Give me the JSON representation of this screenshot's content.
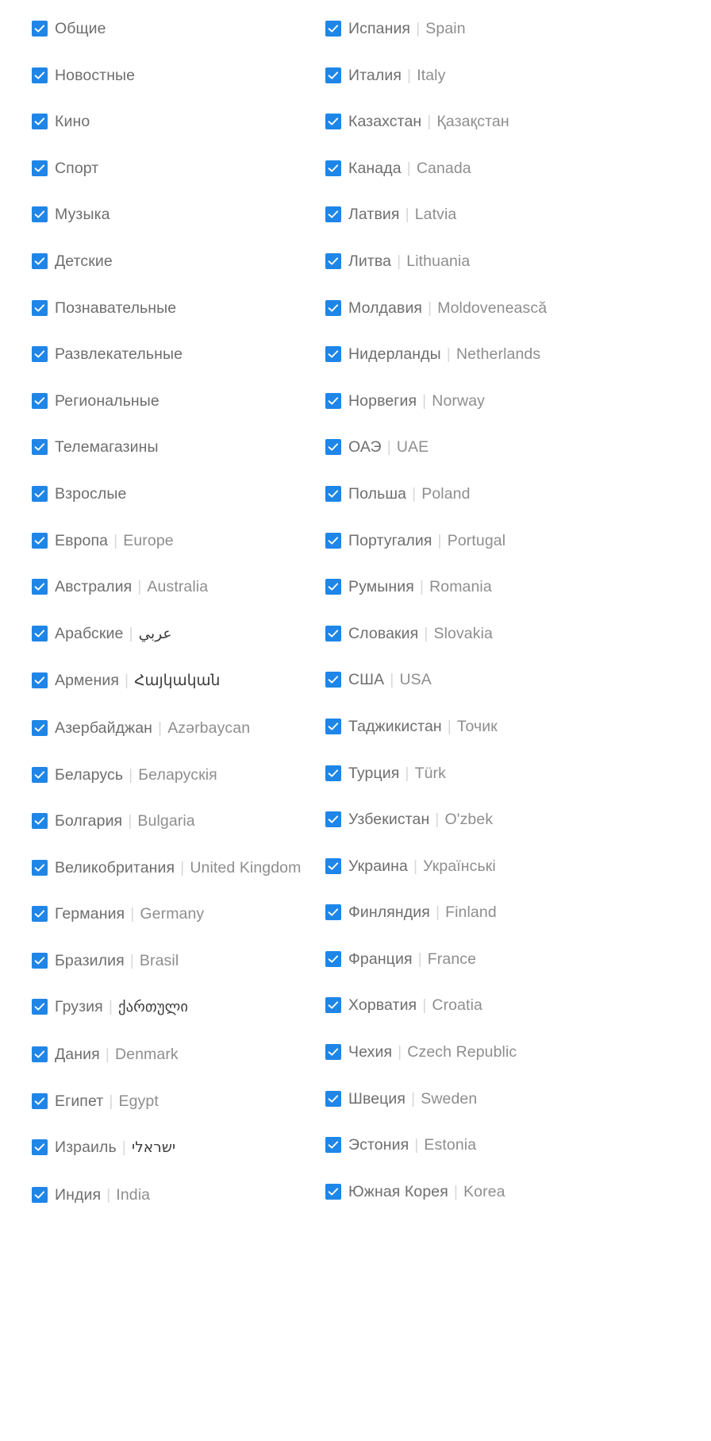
{
  "icons": {
    "checkbox_checked": "checkbox-checked-icon"
  },
  "colors": {
    "checkbox_fill": "#1f86e8",
    "checkmark": "#ffffff",
    "label_primary": "#6e6e6e",
    "label_secondary": "#8e8e8e",
    "separator": "#d8d8d8",
    "background": "#ffffff"
  },
  "separator": "|",
  "left_column": {
    "items": [
      {
        "main": "Общие",
        "sub": "",
        "script": ""
      },
      {
        "main": "Новостные",
        "sub": "",
        "script": ""
      },
      {
        "main": "Кино",
        "sub": "",
        "script": ""
      },
      {
        "main": "Спорт",
        "sub": "",
        "script": ""
      },
      {
        "main": "Музыка",
        "sub": "",
        "script": ""
      },
      {
        "main": "Детские",
        "sub": "",
        "script": ""
      },
      {
        "main": "Познавательные",
        "sub": "",
        "script": ""
      },
      {
        "main": "Развлекательные",
        "sub": "",
        "script": ""
      },
      {
        "main": "Региональные",
        "sub": "",
        "script": ""
      },
      {
        "main": "Телемагазины",
        "sub": "",
        "script": ""
      },
      {
        "main": "Взрослые",
        "sub": "",
        "script": ""
      },
      {
        "main": "Европа",
        "sub": "Europe",
        "script": ""
      },
      {
        "main": "Австралия",
        "sub": "Australia",
        "script": ""
      },
      {
        "main": "Арабские",
        "sub": "عربي",
        "script": "arabic"
      },
      {
        "main": "Армения",
        "sub": "Հայկական",
        "script": "armenian"
      },
      {
        "main": "Азербайджан",
        "sub": "Azərbaycan",
        "script": ""
      },
      {
        "main": "Беларусь",
        "sub": "Беларускія",
        "script": ""
      },
      {
        "main": "Болгария",
        "sub": "Bulgaria",
        "script": ""
      },
      {
        "main": "Великобритания",
        "sub": "United Kingdom",
        "script": ""
      },
      {
        "main": "Германия",
        "sub": "Germany",
        "script": ""
      },
      {
        "main": "Бразилия",
        "sub": "Brasil",
        "script": ""
      },
      {
        "main": "Грузия",
        "sub": "ქართული",
        "script": "georgian"
      },
      {
        "main": "Дания",
        "sub": "Denmark",
        "script": ""
      },
      {
        "main": "Египет",
        "sub": "Egypt",
        "script": ""
      },
      {
        "main": "Израиль",
        "sub": "ישראלי",
        "script": "hebrew"
      },
      {
        "main": "Индия",
        "sub": "India",
        "script": ""
      }
    ]
  },
  "right_column": {
    "items": [
      {
        "main": "Испания",
        "sub": "Spain",
        "script": ""
      },
      {
        "main": "Италия",
        "sub": "Italy",
        "script": ""
      },
      {
        "main": "Казахстан",
        "sub": "Қазақстан",
        "script": ""
      },
      {
        "main": "Канада",
        "sub": "Canada",
        "script": ""
      },
      {
        "main": "Латвия",
        "sub": "Latvia",
        "script": ""
      },
      {
        "main": "Литва",
        "sub": "Lithuania",
        "script": ""
      },
      {
        "main": "Молдавия",
        "sub": "Moldovenească",
        "script": ""
      },
      {
        "main": "Нидерланды",
        "sub": "Netherlands",
        "script": ""
      },
      {
        "main": "Норвегия",
        "sub": "Norway",
        "script": ""
      },
      {
        "main": "ОАЭ",
        "sub": "UAE",
        "script": ""
      },
      {
        "main": "Польша",
        "sub": "Poland",
        "script": ""
      },
      {
        "main": "Португалия",
        "sub": "Portugal",
        "script": ""
      },
      {
        "main": "Румыния",
        "sub": "Romania",
        "script": ""
      },
      {
        "main": "Словакия",
        "sub": "Slovakia",
        "script": ""
      },
      {
        "main": "США",
        "sub": "USA",
        "script": ""
      },
      {
        "main": "Таджикистан",
        "sub": "Точик",
        "script": ""
      },
      {
        "main": "Турция",
        "sub": "Türk",
        "script": ""
      },
      {
        "main": "Узбекистан",
        "sub": "O'zbek",
        "script": ""
      },
      {
        "main": "Украина",
        "sub": "Українські",
        "script": ""
      },
      {
        "main": "Финляндия",
        "sub": "Finland",
        "script": ""
      },
      {
        "main": "Франция",
        "sub": "France",
        "script": ""
      },
      {
        "main": "Хорватия",
        "sub": "Croatia",
        "script": ""
      },
      {
        "main": "Чехия",
        "sub": "Czech Republic",
        "script": ""
      },
      {
        "main": "Швеция",
        "sub": "Sweden",
        "script": ""
      },
      {
        "main": "Эстония",
        "sub": "Estonia",
        "script": ""
      },
      {
        "main": "Южная Корея",
        "sub": "Korea",
        "script": ""
      }
    ]
  }
}
